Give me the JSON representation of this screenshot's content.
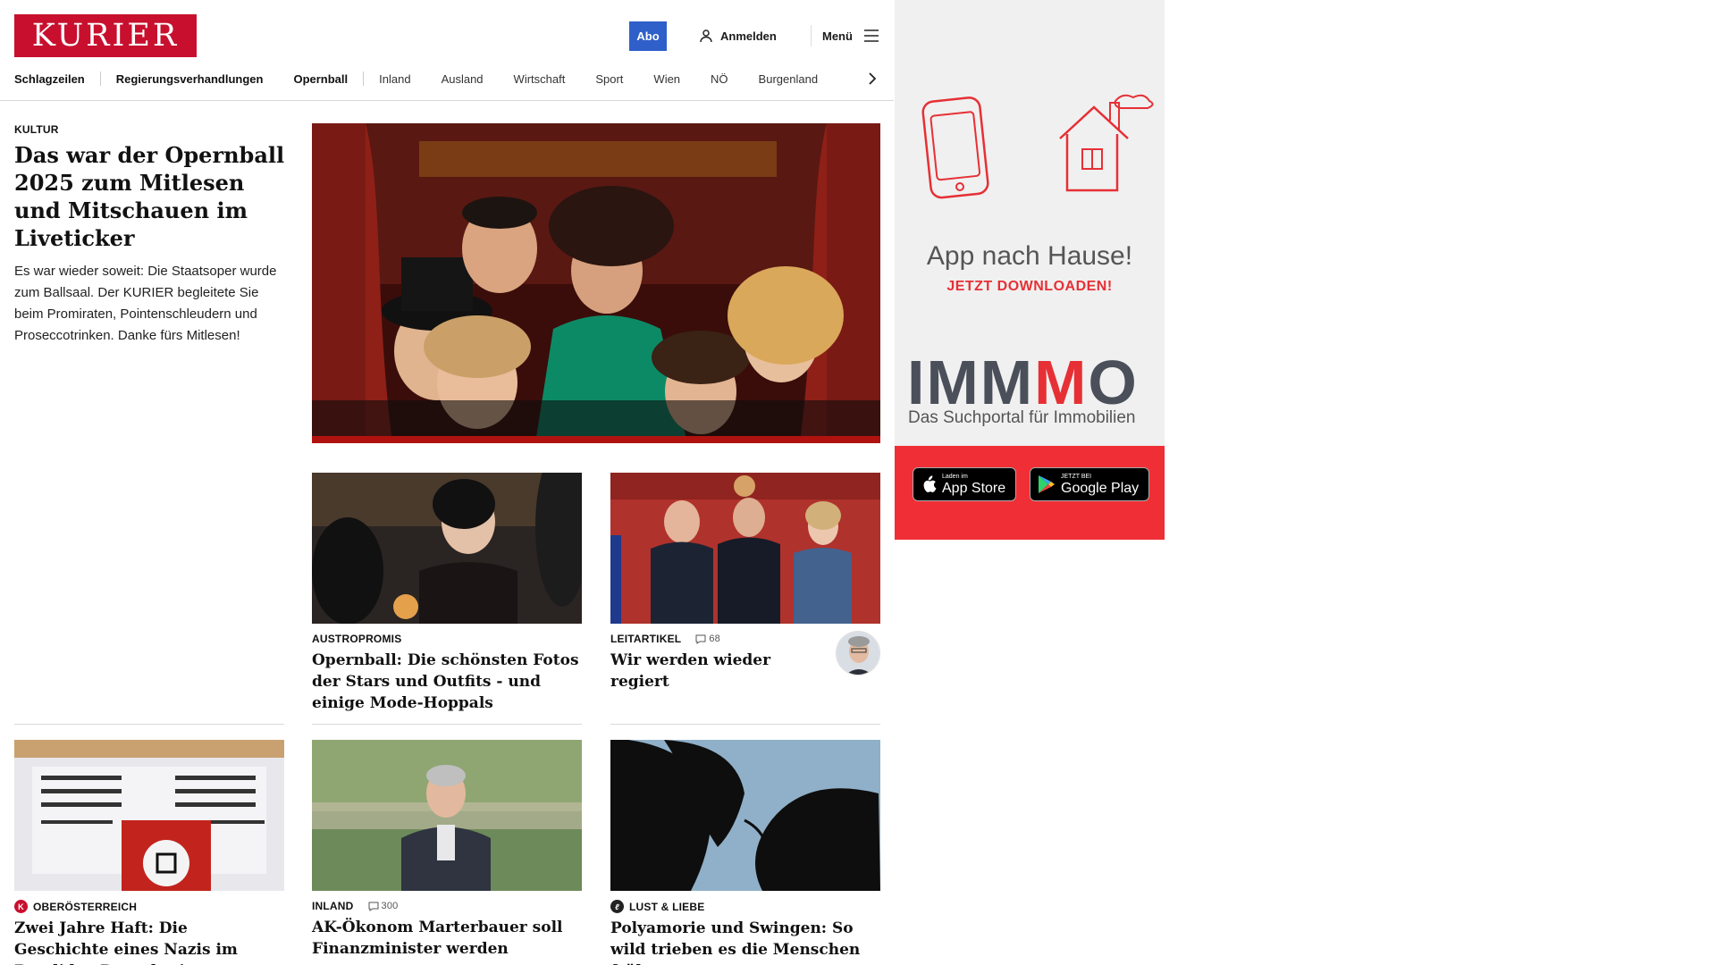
{
  "header": {
    "logo": "KURIER",
    "abo_label": "Abo",
    "login_label": "Anmelden",
    "menu_label": "Menü",
    "nav": [
      "Schlagzeilen",
      "Regierungsverhandlungen",
      "Opernball",
      "Inland",
      "Ausland",
      "Wirtschaft",
      "Sport",
      "Wien",
      "NÖ",
      "Burgenland"
    ]
  },
  "lead": {
    "kicker": "KULTUR",
    "title": "Das war der Opernball 2025 zum Mitlesen und Mitschauen im Liveticker",
    "teaser": "Es war wieder soweit: Die Staatsoper wurde zum Ballsaal. Der KURIER begleitete Sie beim Promiraten, Pointenschleudern und Proseccotrinken. Danke fürs Mitlesen!"
  },
  "cards": [
    {
      "kicker": "AUSTROPROMIS",
      "title": "Opernball: Die schönsten Fotos der Stars und Outfits - und einige Mode-Hoppals"
    },
    {
      "kicker": "LEITARTIKEL",
      "comments": "68",
      "title": "Wir werden wieder regiert"
    },
    {
      "kicker": "OBERÖSTERREICH",
      "title": "Zwei Jahre Haft: Die Geschichte eines Nazis im Bandidos-Dunstkreis"
    },
    {
      "kicker": "INLAND",
      "comments": "300",
      "title": "AK-Ökonom Marterbauer soll Finanzminister werden"
    },
    {
      "kicker": "LUST & LIEBE",
      "title": "Polyamorie und Swingen: So wild trieben es die Menschen früher"
    }
  ],
  "ad": {
    "headline": "App nach Hause!",
    "subline": "JETZT DOWNLOADEN!",
    "brand_a": "IMM",
    "brand_b": "M",
    "brand_c": "O",
    "brand_sub": "Das Suchportal für Immobilien",
    "appstore_small": "Laden im",
    "appstore_big": "App Store",
    "googleplay_small": "JETZT BEI",
    "googleplay_big": "Google Play"
  },
  "colors": {
    "brand": "#c8102e",
    "abo": "#2f5fc9",
    "ad_red": "#f02e35"
  }
}
